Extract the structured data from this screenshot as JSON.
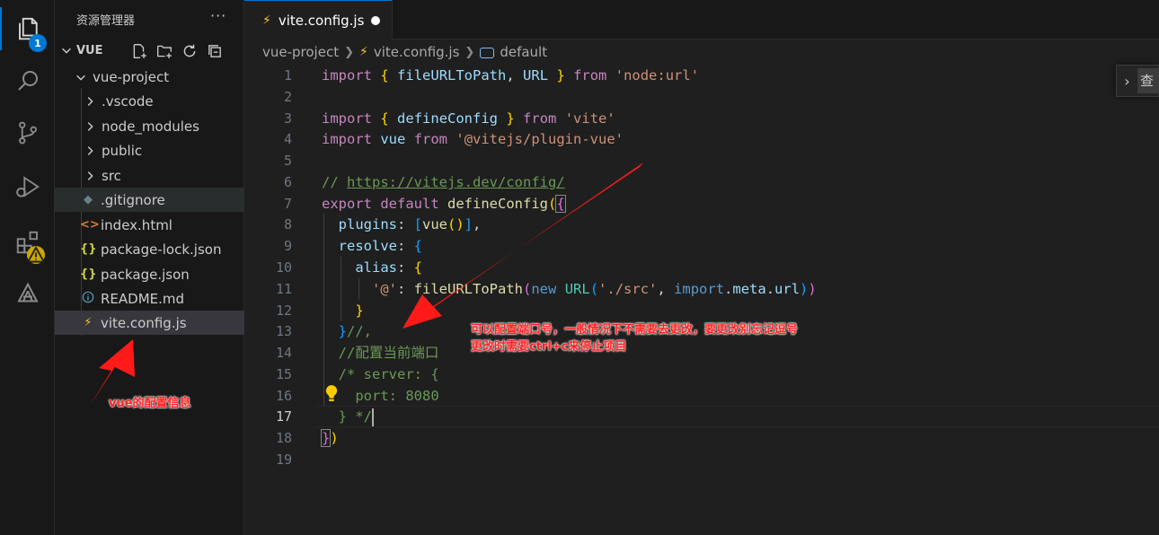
{
  "activity_bar": {
    "explorer_badge": "1"
  },
  "sidebar": {
    "title": "资源管理器",
    "more": "···",
    "section": "VUE",
    "tree": [
      {
        "label": "vue-project",
        "kind": "folder-open",
        "indent": 0
      },
      {
        "label": ".vscode",
        "kind": "folder",
        "indent": 1
      },
      {
        "label": "node_modules",
        "kind": "folder",
        "indent": 1
      },
      {
        "label": "public",
        "kind": "folder",
        "indent": 1
      },
      {
        "label": "src",
        "kind": "folder",
        "indent": 1
      },
      {
        "label": ".gitignore",
        "kind": "gitignore",
        "indent": 1
      },
      {
        "label": "index.html",
        "kind": "html",
        "indent": 1
      },
      {
        "label": "package-lock.json",
        "kind": "json",
        "indent": 1
      },
      {
        "label": "package.json",
        "kind": "json",
        "indent": 1
      },
      {
        "label": "README.md",
        "kind": "info",
        "indent": 1
      },
      {
        "label": "vite.config.js",
        "kind": "js",
        "indent": 1
      }
    ]
  },
  "tab": {
    "label": "vite.config.js"
  },
  "breadcrumb": {
    "folder": "vue-project",
    "file": "vite.config.js",
    "symbol": "default"
  },
  "editor": {
    "active_line": 17,
    "line_count": 19
  },
  "find_widget": {
    "text": "查"
  },
  "annotations": {
    "sidebar_note": "vue的配置信息",
    "editor_note_1": "可以配置端口号，一般情况下不需要去更改，要更改别忘记逗号",
    "editor_note_2": "更改时需要ctrl+c来停止项目"
  },
  "colors": {
    "accent": "#0078d4",
    "annotation": "#ff2020",
    "js_icon": "#f1c232"
  }
}
